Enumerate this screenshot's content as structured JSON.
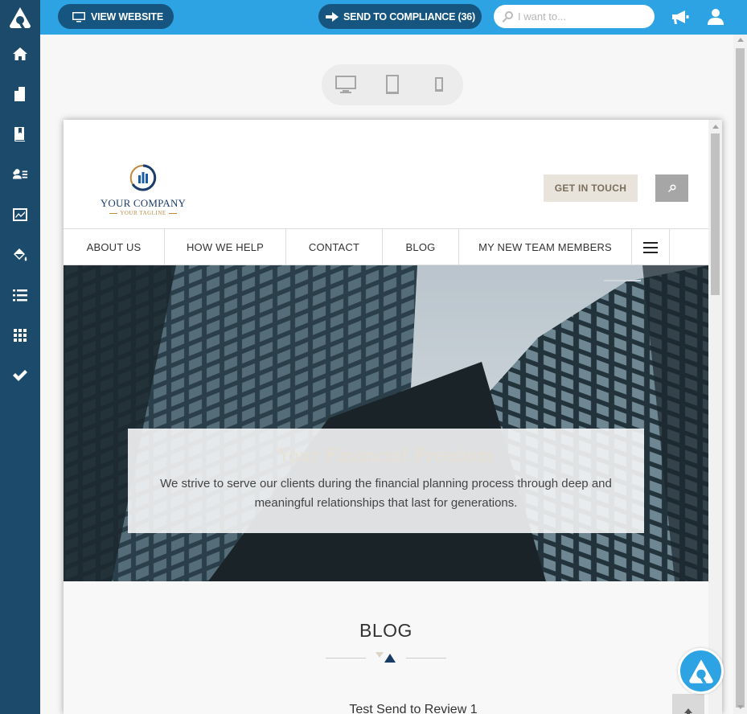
{
  "topbar": {
    "view_website_label": "VIEW WEBSITE",
    "send_compliance_label": "SEND TO COMPLIANCE (36)",
    "search_placeholder": "I want to..."
  },
  "sidebar": {
    "items": [
      {
        "name": "home",
        "icon": "home-icon"
      },
      {
        "name": "pages",
        "icon": "pages-icon"
      },
      {
        "name": "content",
        "icon": "book-icon"
      },
      {
        "name": "contacts",
        "icon": "users-icon"
      },
      {
        "name": "analytics",
        "icon": "chart-icon"
      },
      {
        "name": "design",
        "icon": "paint-bucket-icon"
      },
      {
        "name": "lists",
        "icon": "list-icon"
      },
      {
        "name": "apps",
        "icon": "grid-icon"
      },
      {
        "name": "compliance",
        "icon": "checkmark-icon"
      }
    ]
  },
  "preview": {
    "company": {
      "name": "YOUR COMPANY",
      "tagline": "YOUR TAGLINE"
    },
    "get_in_touch_label": "GET IN TOUCH",
    "nav": [
      {
        "label": "ABOUT US"
      },
      {
        "label": "HOW WE HELP"
      },
      {
        "label": "CONTACT"
      },
      {
        "label": "BLOG"
      },
      {
        "label": "MY NEW TEAM MEMBERS"
      }
    ],
    "hero": {
      "title": "Your Financial Freedom",
      "text": "We strive to serve our clients during the financial planning process through deep and meaningful relationships that last for generations."
    },
    "blog": {
      "title": "BLOG",
      "post_title": "Test Send to Review 1"
    }
  },
  "colors": {
    "sidebar": "#1b4a6b",
    "topbar": "#2ea3e3",
    "pill": "#15557f"
  }
}
